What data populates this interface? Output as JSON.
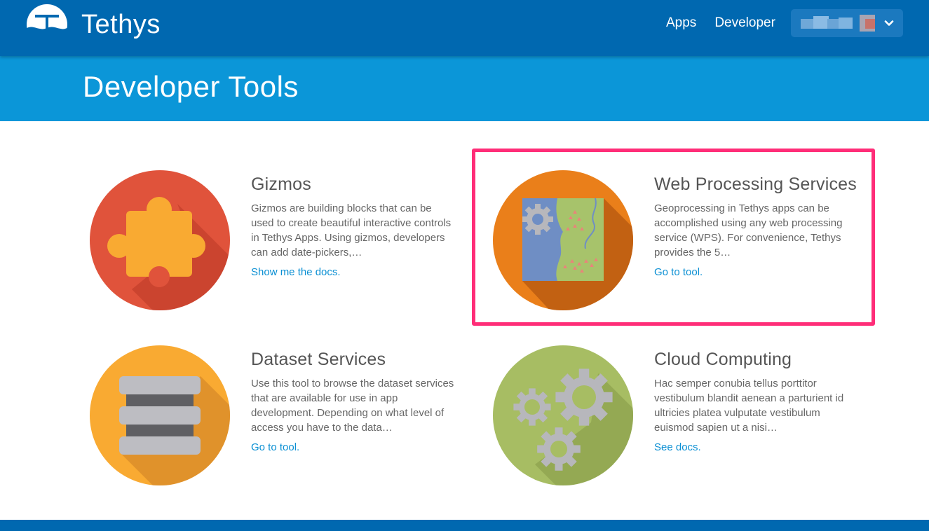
{
  "navbar": {
    "brand_name": "Tethys",
    "links": [
      {
        "label": "Apps"
      },
      {
        "label": "Developer"
      }
    ],
    "user_menu": {
      "icon": "chevron-down-icon"
    }
  },
  "header": {
    "title": "Developer Tools"
  },
  "tools": [
    {
      "title": "Gizmos",
      "description": "Gizmos are building blocks that can be used to create beautiful interactive controls in Tethys Apps. Using gizmos, developers can add date-pickers,…",
      "link": "Show me the docs.",
      "icon": "puzzle-piece-icon",
      "color": "#e0533b"
    },
    {
      "title": "Web Processing Services",
      "description": "Geoprocessing in Tethys apps can be accomplished using any web processing service (WPS). For convenience, Tethys provides the 5…",
      "link": "Go to tool.",
      "icon": "map-gear-icon",
      "color": "#ea7f1a"
    },
    {
      "title": "Dataset Services",
      "description": "Use this tool to browse the dataset services that are available for use in app development. Depending on what level of access you have to the data…",
      "link": "Go to tool.",
      "icon": "database-icon",
      "color": "#f9aa32"
    },
    {
      "title": "Cloud Computing",
      "description": "Hac semper conubia tellus porttitor vestibulum blandit aenean a parturient id ultricies platea vulputate vestibulum euismod sapien ut a nisi…",
      "link": "See docs.",
      "icon": "gears-icon",
      "color": "#a7bd63"
    }
  ],
  "colors": {
    "navbar": "#0068b0",
    "header": "#0b96d8",
    "link": "#0a8fd3",
    "highlight": "#ff2d78"
  }
}
